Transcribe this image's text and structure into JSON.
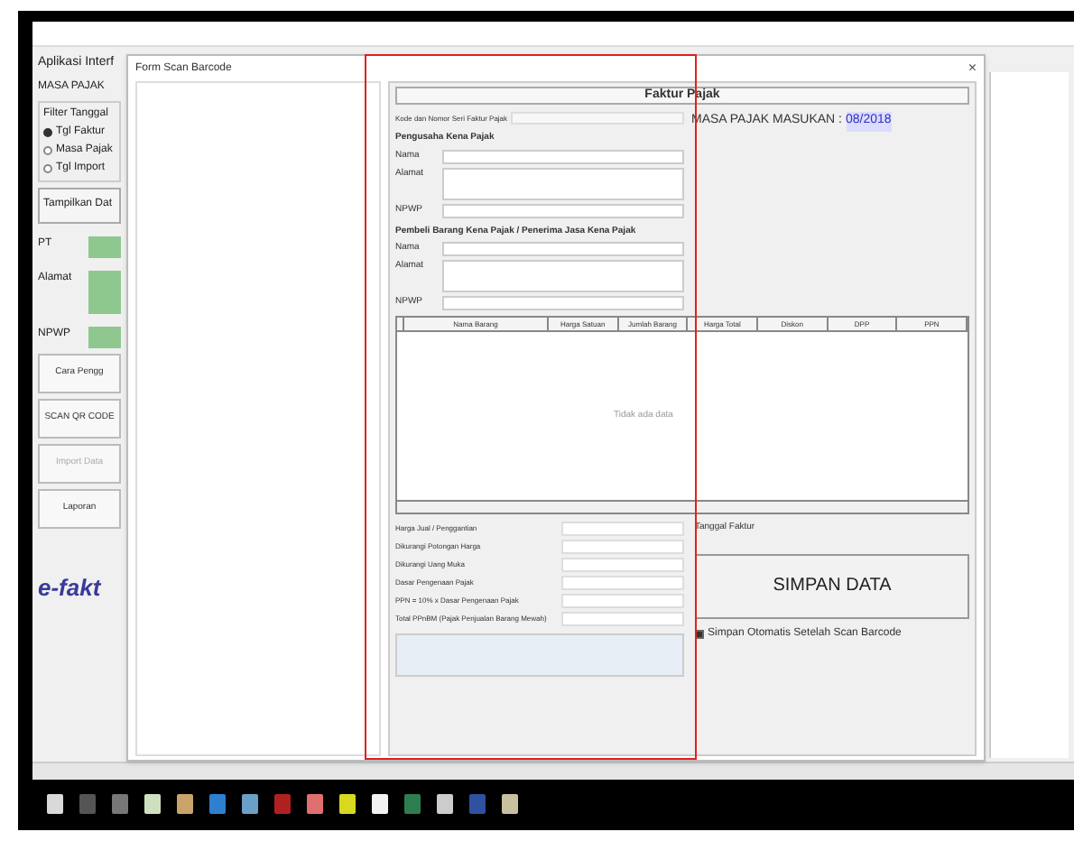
{
  "main_window": {
    "app_title": "Aplikasi Interf",
    "period_label": "MASA PAJAK",
    "filter": {
      "title": "Filter Tanggal",
      "options": [
        {
          "label": "Tgl Faktur",
          "selected": true
        },
        {
          "label": "Masa Pajak",
          "selected": false
        },
        {
          "label": "Tgl Import",
          "selected": false
        }
      ]
    },
    "show_button": "Tampilkan Dat",
    "info_rows": [
      {
        "label": "PT",
        "kind": "line"
      },
      {
        "label": "Alamat",
        "kind": "area"
      },
      {
        "label": "NPWP",
        "kind": "line"
      }
    ],
    "buttons": [
      {
        "label": "Cara Pengg",
        "disabled": false
      },
      {
        "label": "SCAN QR CODE",
        "disabled": false
      },
      {
        "label": "Import Data",
        "disabled": true
      },
      {
        "label": "Laporan",
        "disabled": false
      }
    ],
    "logo": "e-fakt"
  },
  "scan_dialog": {
    "title": "Form Scan Barcode",
    "close_glyph": "×",
    "form": {
      "heading": "Faktur Pajak",
      "number_label": "Kode dan Nomor Seri Faktur Pajak",
      "period_label": "MASA PAJAK MASUKAN :",
      "period_value": "08/2018",
      "sections": [
        {
          "heading": "Pengusaha Kena Pajak",
          "fields": [
            {
              "label": "Nama",
              "kind": "line"
            },
            {
              "label": "Alamat",
              "kind": "area"
            },
            {
              "label": "NPWP",
              "kind": "line"
            }
          ]
        },
        {
          "heading": "Pembeli Barang Kena Pajak / Penerima Jasa Kena Pajak",
          "fields": [
            {
              "label": "Nama",
              "kind": "line"
            },
            {
              "label": "Alamat",
              "kind": "area"
            },
            {
              "label": "NPWP",
              "kind": "line"
            }
          ]
        }
      ],
      "columns": [
        "Nama Barang",
        "Harga Satuan",
        "Jumlah Barang",
        "Harga Total",
        "Diskon",
        "DPP",
        "PPN"
      ],
      "empty_text": "Tidak ada data",
      "totals": [
        "Harga Jual / Penggantian",
        "Dikurangi Potongan Harga",
        "Dikurangi Uang Muka",
        "Dasar Pengenaan Pajak",
        "PPN = 10% x Dasar Pengenaan Pajak",
        "Total PPnBM (Pajak Penjualan Barang Mewah)"
      ],
      "date_label": "Tanggal Faktur",
      "save_button": "SIMPAN DATA",
      "auto_save": {
        "label": "Simpan Otomatis Setelah Scan Barcode",
        "checked": true
      }
    }
  }
}
